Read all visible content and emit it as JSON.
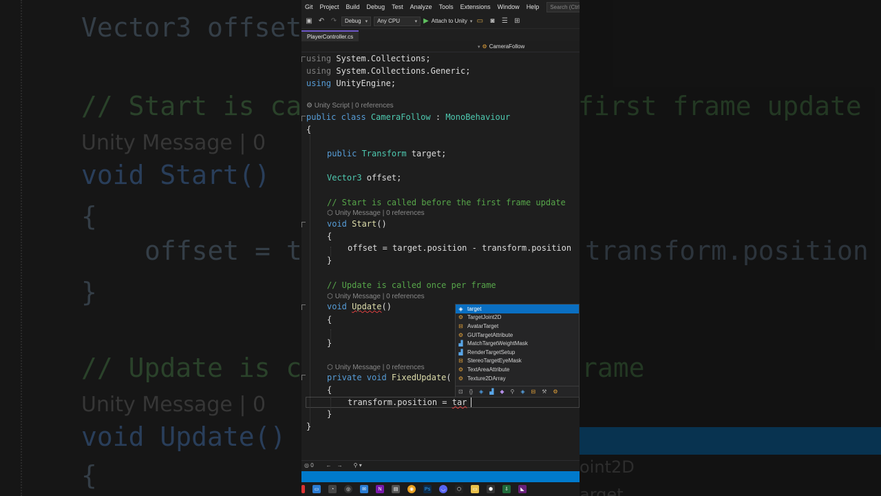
{
  "background": {
    "lines": [
      "Vector3 offset",
      "// Start is ca",
      "first frame update",
      "Unity Message | 0",
      "void Start()",
      "{",
      "offset = t",
      "transform.position",
      "}",
      "// Update is c",
      "rame",
      "Unity Message | 0",
      "void Update()",
      "{",
      "oint2D",
      "arget"
    ]
  },
  "menubar": {
    "items": [
      "Git",
      "Project",
      "Build",
      "Debug",
      "Test",
      "Analyze",
      "Tools",
      "Extensions",
      "Window",
      "Help"
    ],
    "search_placeholder": "Search (Ctrl+Q)"
  },
  "toolbar": {
    "config": "Debug",
    "platform": "Any CPU",
    "attach": "Attach to Unity"
  },
  "tab": {
    "filename": "PlayerController.cs"
  },
  "navbar": {
    "class_name": "CameraFollow"
  },
  "code": {
    "line1_kw": "using",
    "line1_ns": " System.Collections;",
    "line2_kw": "using",
    "line2_ns": " System.Collections.Generic;",
    "line3_kw": "using",
    "line3_ns": " UnityEngine;",
    "lens_class": "Unity Script | 0 references",
    "class_kw": "public class ",
    "class_name": "CameraFollow",
    "class_sep": " : ",
    "class_base": "MonoBehaviour",
    "brace_open": "{",
    "field1_kw": "public ",
    "field1_type": "Transform",
    "field1_rest": " target;",
    "field2_type": "Vector3",
    "field2_rest": " offset;",
    "comment_start": "// Start is called before the first frame update",
    "lens_msg": "Unity Message | 0 references",
    "start_kw": "void ",
    "start_name": "Start",
    "start_paren": "()",
    "start_open": "{",
    "start_body": "offset = target.position - transform.position",
    "start_close": "}",
    "comment_update": "// Update is called once per frame",
    "update_kw": "void ",
    "update_name": "Update",
    "update_paren": "()",
    "update_open": "{",
    "update_close": "}",
    "fixed_kw": "private void ",
    "fixed_name": "FixedUpdate",
    "fixed_paren": "(",
    "fixed_open": "{",
    "fixed_body": "transform.position = ",
    "fixed_typed": "tar",
    "fixed_close": "}",
    "brace_close": "}"
  },
  "intellisense": {
    "items": [
      {
        "label": "target",
        "icon": "field-icon",
        "selected": true
      },
      {
        "label": "TargetJoint2D",
        "icon": "class-icon"
      },
      {
        "label": "AvatarTarget",
        "icon": "enum-icon"
      },
      {
        "label": "GUITargetAttribute",
        "icon": "class-icon"
      },
      {
        "label": "MatchTargetWeightMask",
        "icon": "struct-icon"
      },
      {
        "label": "RenderTargetSetup",
        "icon": "struct-icon"
      },
      {
        "label": "StereoTargetEyeMask",
        "icon": "enum-icon"
      },
      {
        "label": "TextAreaAttribute",
        "icon": "class-icon"
      },
      {
        "label": "Texture2DArray",
        "icon": "class-icon"
      }
    ]
  },
  "statusline": {
    "errors": "0"
  },
  "colors": {
    "accent": "#007acc",
    "selection": "#0a6fc2",
    "tab_accent": "#6e58c8"
  }
}
